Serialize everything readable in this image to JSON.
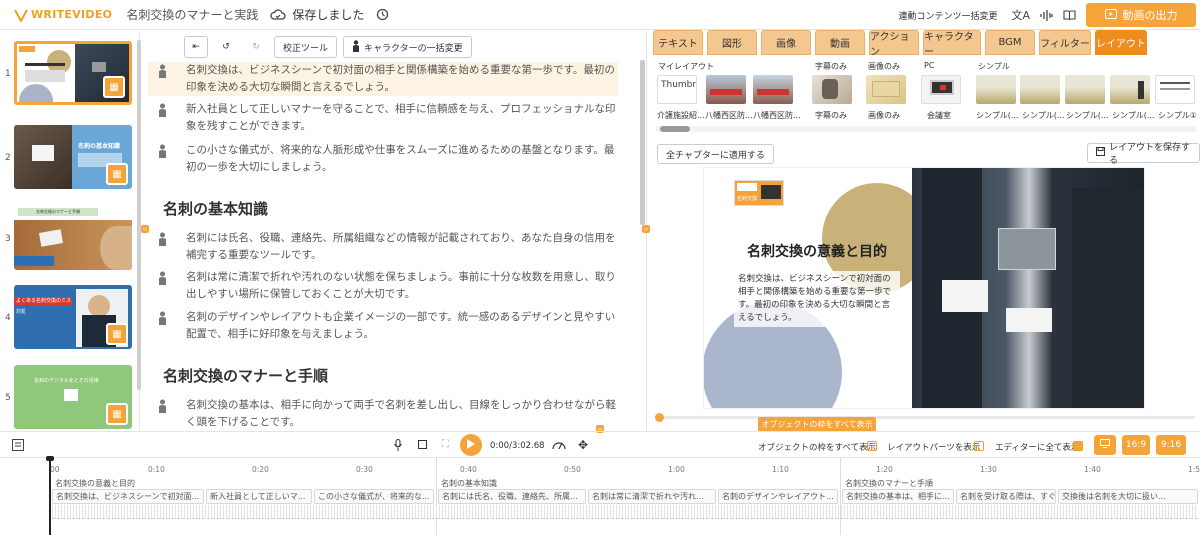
{
  "header": {
    "logo_text": "WRITEVIDEO",
    "project_title": "名刺交換のマナーと実践",
    "save_status": "保存しました",
    "bulk_change_label": "連動コンテンツ一括変更",
    "export_label": "動画の出力"
  },
  "thumbnails": [
    {
      "number": "1",
      "selected": true
    },
    {
      "number": "2",
      "selected": false
    },
    {
      "number": "3",
      "selected": false
    },
    {
      "number": "4",
      "selected": false
    },
    {
      "number": "5",
      "selected": false
    }
  ],
  "thumb_texts": {
    "t2_title": "名刺の基本知識",
    "t3_title": "名刺交換のマナーと手順",
    "t4_title": "よくある名刺交換のミスとその対処法",
    "t4_sub": "対処",
    "t5_title": "名刺のデジタル化とその活用"
  },
  "editor_toolbar": {
    "proofread_label": "校正ツール",
    "character_bulk_label": "キャラクターの一括変更"
  },
  "script": {
    "lines": [
      {
        "text": "名刺交換は、ビジネスシーンで初対面の相手と関係構築を始める重要な第一歩です。最初の印象を決める大切な瞬間と言えるでしょう。"
      },
      {
        "text": "新入社員として正しいマナーを守ることで、相手に信頼感を与え、プロフェッショナルな印象を残すことができます。"
      },
      {
        "text": "この小さな儀式が、将来的な人脈形成や仕事をスムーズに進めるための基盤となります。最初の一歩を大切にしましょう。"
      },
      {
        "text": "名刺には氏名、役職、連絡先、所属組織などの情報が記載されており、あなた自身の信用を補完する重要なツールです。"
      },
      {
        "text": "名刺は常に清潔で折れや汚れのない状態を保ちましょう。事前に十分な枚数を用意し、取り出しやすい場所に保管しておくことが大切です。"
      },
      {
        "text": "名刺のデザインやレイアウトも企業イメージの一部です。統一感のあるデザインと見やすい配置で、相手に好印象を与えましょう。"
      },
      {
        "text": "名刺交換の基本は、相手に向かって両手で名刺を差し出し、目線をしっかり合わせながら軽く頭を下げることです。"
      }
    ],
    "heading_1": "名刺の基本知識",
    "heading_2": "名刺交換のマナーと手順"
  },
  "right_tabs": [
    {
      "label": "テキスト",
      "active": false
    },
    {
      "label": "図形",
      "active": false
    },
    {
      "label": "画像",
      "active": false
    },
    {
      "label": "動画",
      "active": false
    },
    {
      "label": "アクション",
      "active": false
    },
    {
      "label": "キャラクター",
      "active": false
    },
    {
      "label": "BGM",
      "active": false
    },
    {
      "label": "フィルター",
      "active": false
    },
    {
      "label": "レイアウト",
      "active": true
    }
  ],
  "layouts": {
    "categories": {
      "my": "マイレイアウト",
      "subtitle_only": "字幕のみ",
      "image_only": "画像のみ",
      "pc": "PC",
      "simple": "シンプル"
    },
    "thumbnail_placeholder": "Thumbna",
    "items": [
      {
        "name": "介護施設紹..."
      },
      {
        "name": "八幡西区防..."
      },
      {
        "name": "八幡西区防..."
      },
      {
        "name": "字幕のみ"
      },
      {
        "name": "画像のみ"
      },
      {
        "name": "会議室"
      },
      {
        "name": "シンプル(..."
      },
      {
        "name": "シンプル(..."
      },
      {
        "name": "シンプル(..."
      },
      {
        "name": "シンプル(..."
      },
      {
        "name": "シンプル①"
      }
    ],
    "apply_all_label": "全チャプターに適用する",
    "save_layout_label": "レイアウトを保存する"
  },
  "preview": {
    "slide_title": "名刺交換の意義と目的",
    "slide_body": "名刺交換は、ビジネスシーンで初対面の相手と関係構築を始める重要な第一歩です。最初の印象を決める大切な瞬間と言えるでしょう。",
    "logo_text": "名刺交換"
  },
  "player": {
    "time_display": "0:00/3:02.68",
    "show_frames_button": "オブジェクトの枠をすべて表示",
    "show_frames_label": "オブジェクトの枠をすべて表示",
    "show_layout_parts_label": "レイアウトパーツを表示",
    "show_all_in_editor_label": "エディターに全て表示",
    "ratio_16_9": "16:9",
    "ratio_9_16": "9:16"
  },
  "timeline": {
    "ticks": [
      "00",
      "0:10",
      "0:20",
      "0:30",
      "0:40",
      "0:50",
      "1:00",
      "1:10",
      "1:20",
      "1:30",
      "1:40",
      "1:5"
    ],
    "chapters": [
      "名刺交換の意義と目的",
      "名刺の基本知識",
      "名刺交換のマナーと手順"
    ],
    "clips": [
      "名刺交換は、ビジネスシーンで初対面...",
      "新入社員として正しいマ...",
      "この小さな儀式が、将来的な...",
      "名刺には氏名、役職、連絡先、所属...",
      "名刺は常に清潔で折れや汚れ...",
      "名刺のデザインやレイアウト...",
      "名刺交換の基本は、相手に...",
      "名刺を受け取る際は、すぐに...",
      "交換後は名刺を大切に扱い..."
    ]
  },
  "colors": {
    "accent": "#f5a43a",
    "tab_bg": "#f4c78f",
    "tab_active": "#f08c1e"
  }
}
